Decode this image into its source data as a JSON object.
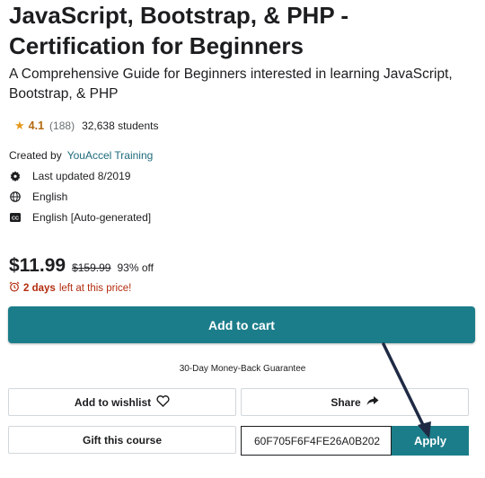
{
  "course": {
    "title": "JavaScript, Bootstrap, & PHP - Certification for Beginners",
    "subtitle": "A Comprehensive Guide for Beginners interested in learning JavaScript, Bootstrap, & PHP",
    "rating": "4.1",
    "rating_count": "(188)",
    "students": "32,638 students",
    "created_by_label": "Created by",
    "author": "YouAccel Training",
    "last_updated": "Last updated 8/2019",
    "language": "English",
    "captions": "English [Auto-generated]"
  },
  "pricing": {
    "price": "$11.99",
    "original_price": "$159.99",
    "discount": "93% off",
    "timer_days": "2 days",
    "timer_text": "left at this price!"
  },
  "actions": {
    "add_to_cart": "Add to cart",
    "guarantee": "30-Day Money-Back Guarantee",
    "wishlist": "Add to wishlist",
    "share": "Share",
    "gift": "Gift this course",
    "coupon_value": "60F705F6F4FE26A0B202",
    "apply": "Apply"
  },
  "icons": {
    "star": "star-icon",
    "update": "update-icon",
    "globe": "globe-icon",
    "captions": "cc-icon",
    "alarm": "alarm-icon",
    "heart": "heart-icon",
    "share": "share-arrow-icon"
  },
  "colors": {
    "accent": "#1c7d8a",
    "rating": "#b4690e",
    "star": "#e59819",
    "timer": "#b32d0f",
    "author_link": "#1e6b7b"
  }
}
